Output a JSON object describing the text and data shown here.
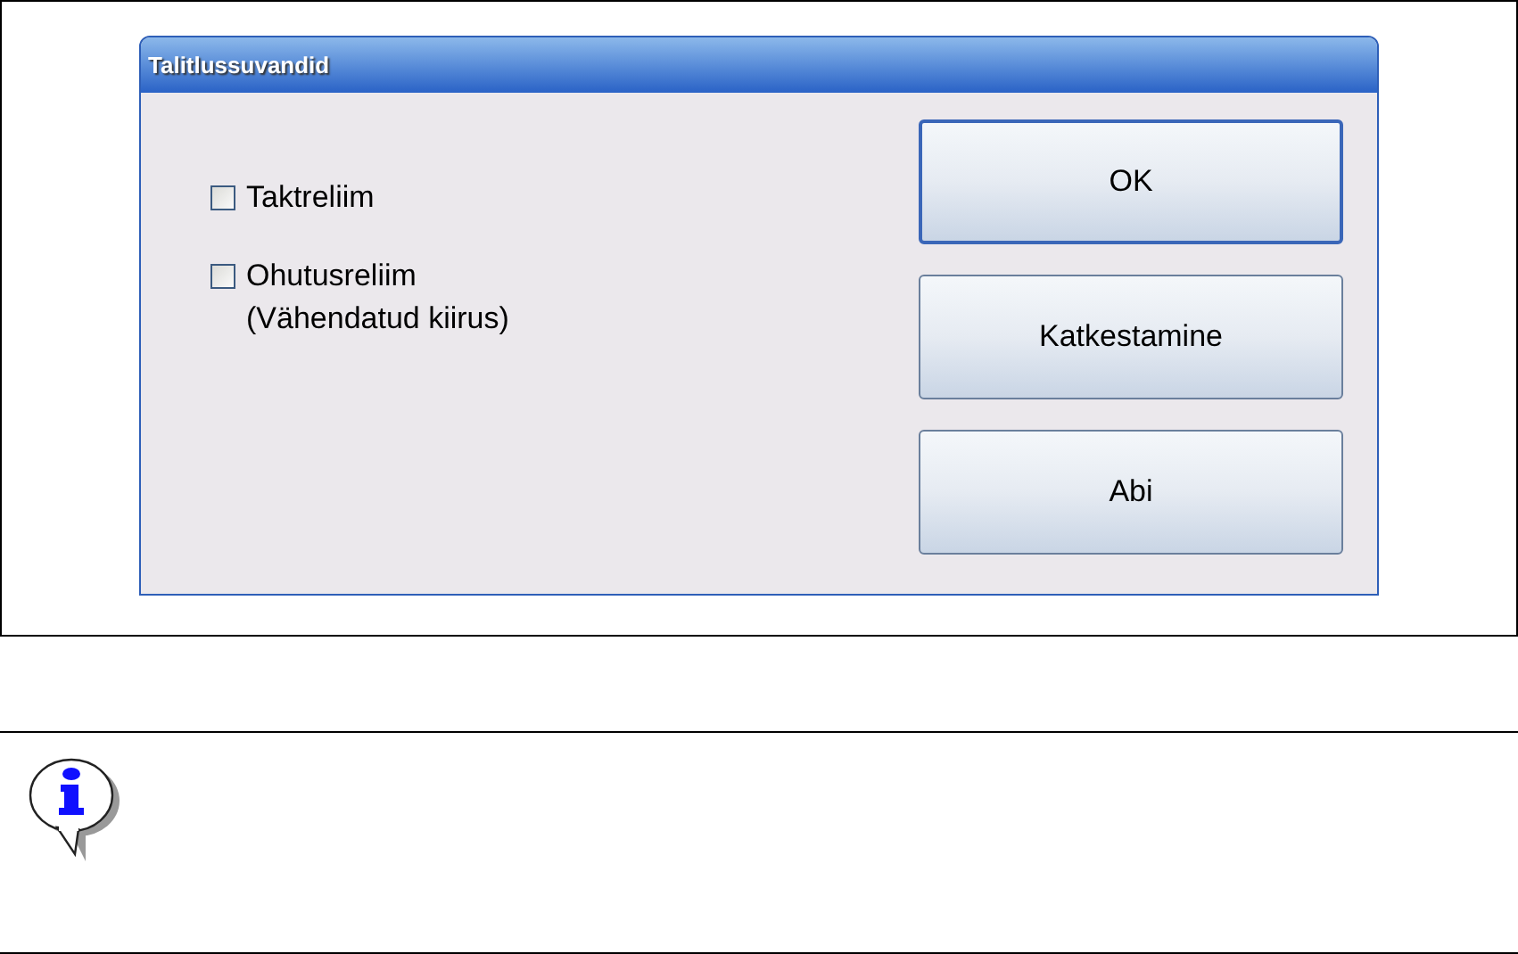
{
  "dialog": {
    "title": "Talitlussuvandid",
    "options": [
      {
        "label": "Taktreliim",
        "checked": false
      },
      {
        "label": "Ohutusreliim",
        "sublabel": "(Vähendatud kiirus)",
        "checked": false
      }
    ],
    "buttons": [
      {
        "label": "OK",
        "default": true
      },
      {
        "label": "Katkestamine",
        "default": false
      },
      {
        "label": "Abi",
        "default": false
      }
    ]
  },
  "note": {
    "kind": "info"
  }
}
